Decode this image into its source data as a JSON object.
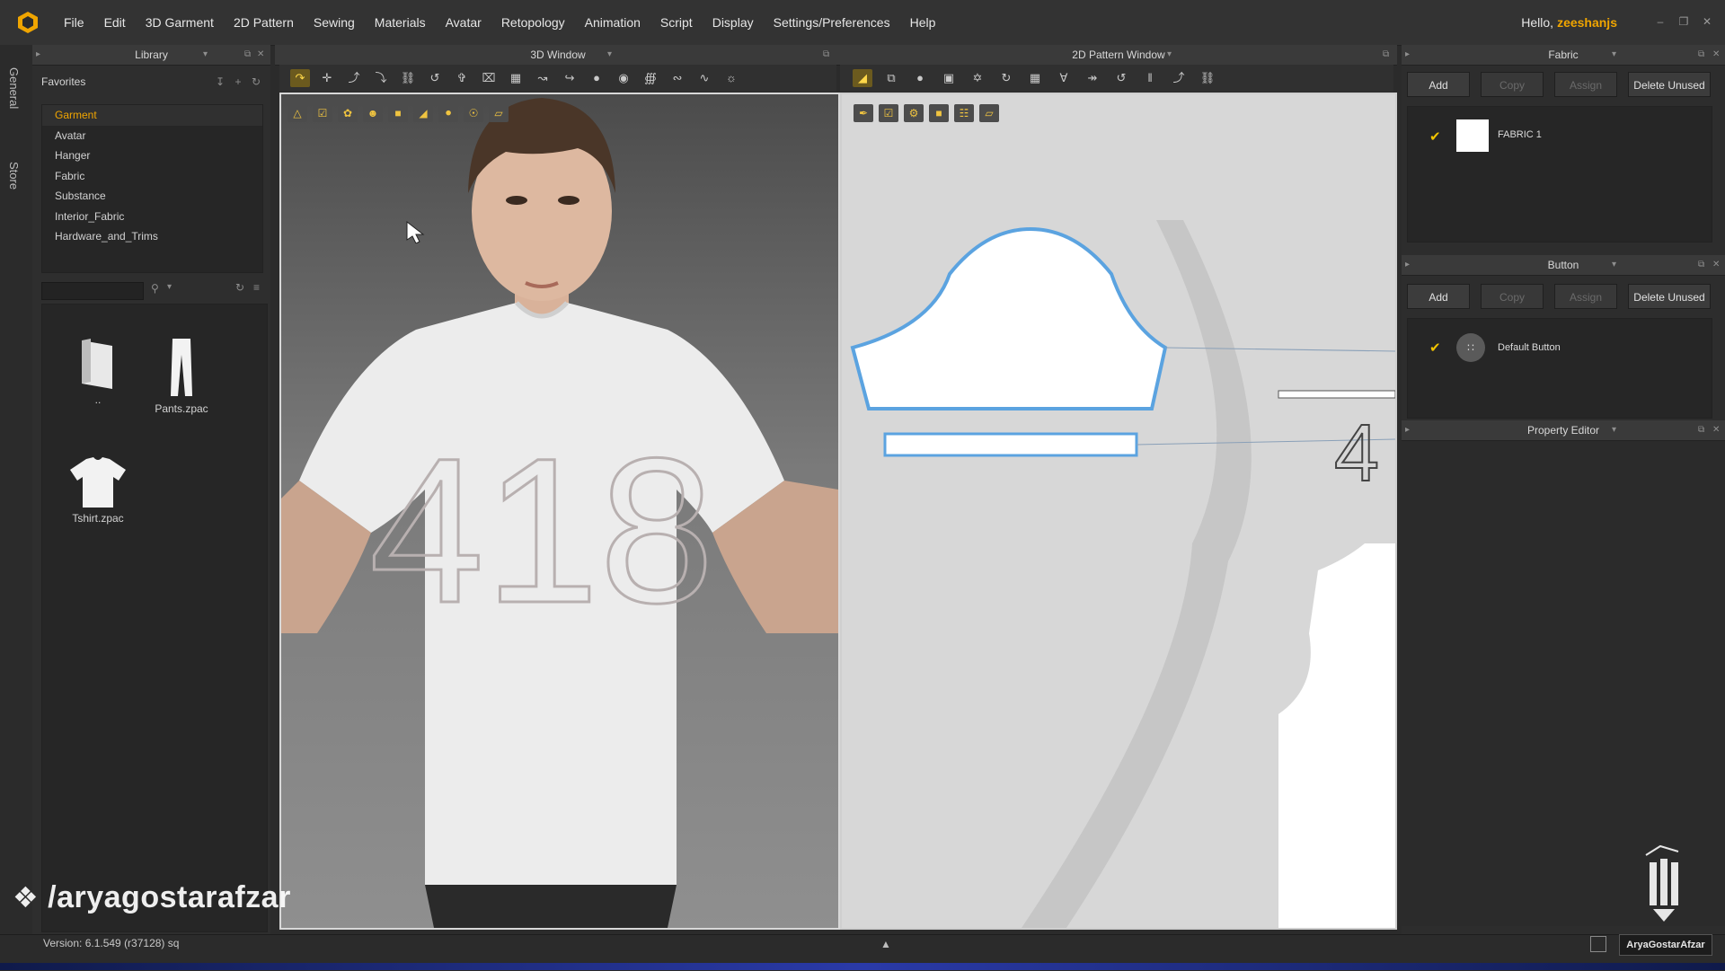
{
  "menu": [
    "File",
    "Edit",
    "3D Garment",
    "2D Pattern",
    "Sewing",
    "Materials",
    "Avatar",
    "Retopology",
    "Animation",
    "Script",
    "Display",
    "Settings/Preferences",
    "Help"
  ],
  "greeting": {
    "prefix": "Hello,",
    "user": "zeeshanjs"
  },
  "vtabs": {
    "general": "General",
    "store": "Store"
  },
  "library": {
    "title": "Library",
    "favorites": "Favorites",
    "tree": [
      "Garment",
      "Avatar",
      "Hanger",
      "Fabric",
      "Substance",
      "Interior_Fabric",
      "Hardware_and_Trims"
    ],
    "items": [
      {
        "label": ".."
      },
      {
        "label": "Pants.zpac"
      },
      {
        "label": "Tshirt.zpac"
      }
    ]
  },
  "window3d": {
    "title": "3D Window",
    "shirt_number": "418"
  },
  "window2d": {
    "title": "2D Pattern Window"
  },
  "fabric": {
    "title": "Fabric",
    "add": "Add",
    "copy": "Copy",
    "assign": "Assign",
    "delete": "Delete Unused",
    "item": "FABRIC 1"
  },
  "button": {
    "title": "Button",
    "add": "Add",
    "copy": "Copy",
    "assign": "Assign",
    "delete": "Delete Unused",
    "item": "Default Button"
  },
  "property": {
    "title": "Property Editor"
  },
  "status": {
    "version": "Version:  6.1.549 (r37128)  sq"
  },
  "watermark": "/aryagostarafzar",
  "brand": "AryaGostarAfzar",
  "colors": {
    "accent": "#f0a500",
    "check": "#f0c300",
    "pattern_outline": "#5ba3e0"
  }
}
